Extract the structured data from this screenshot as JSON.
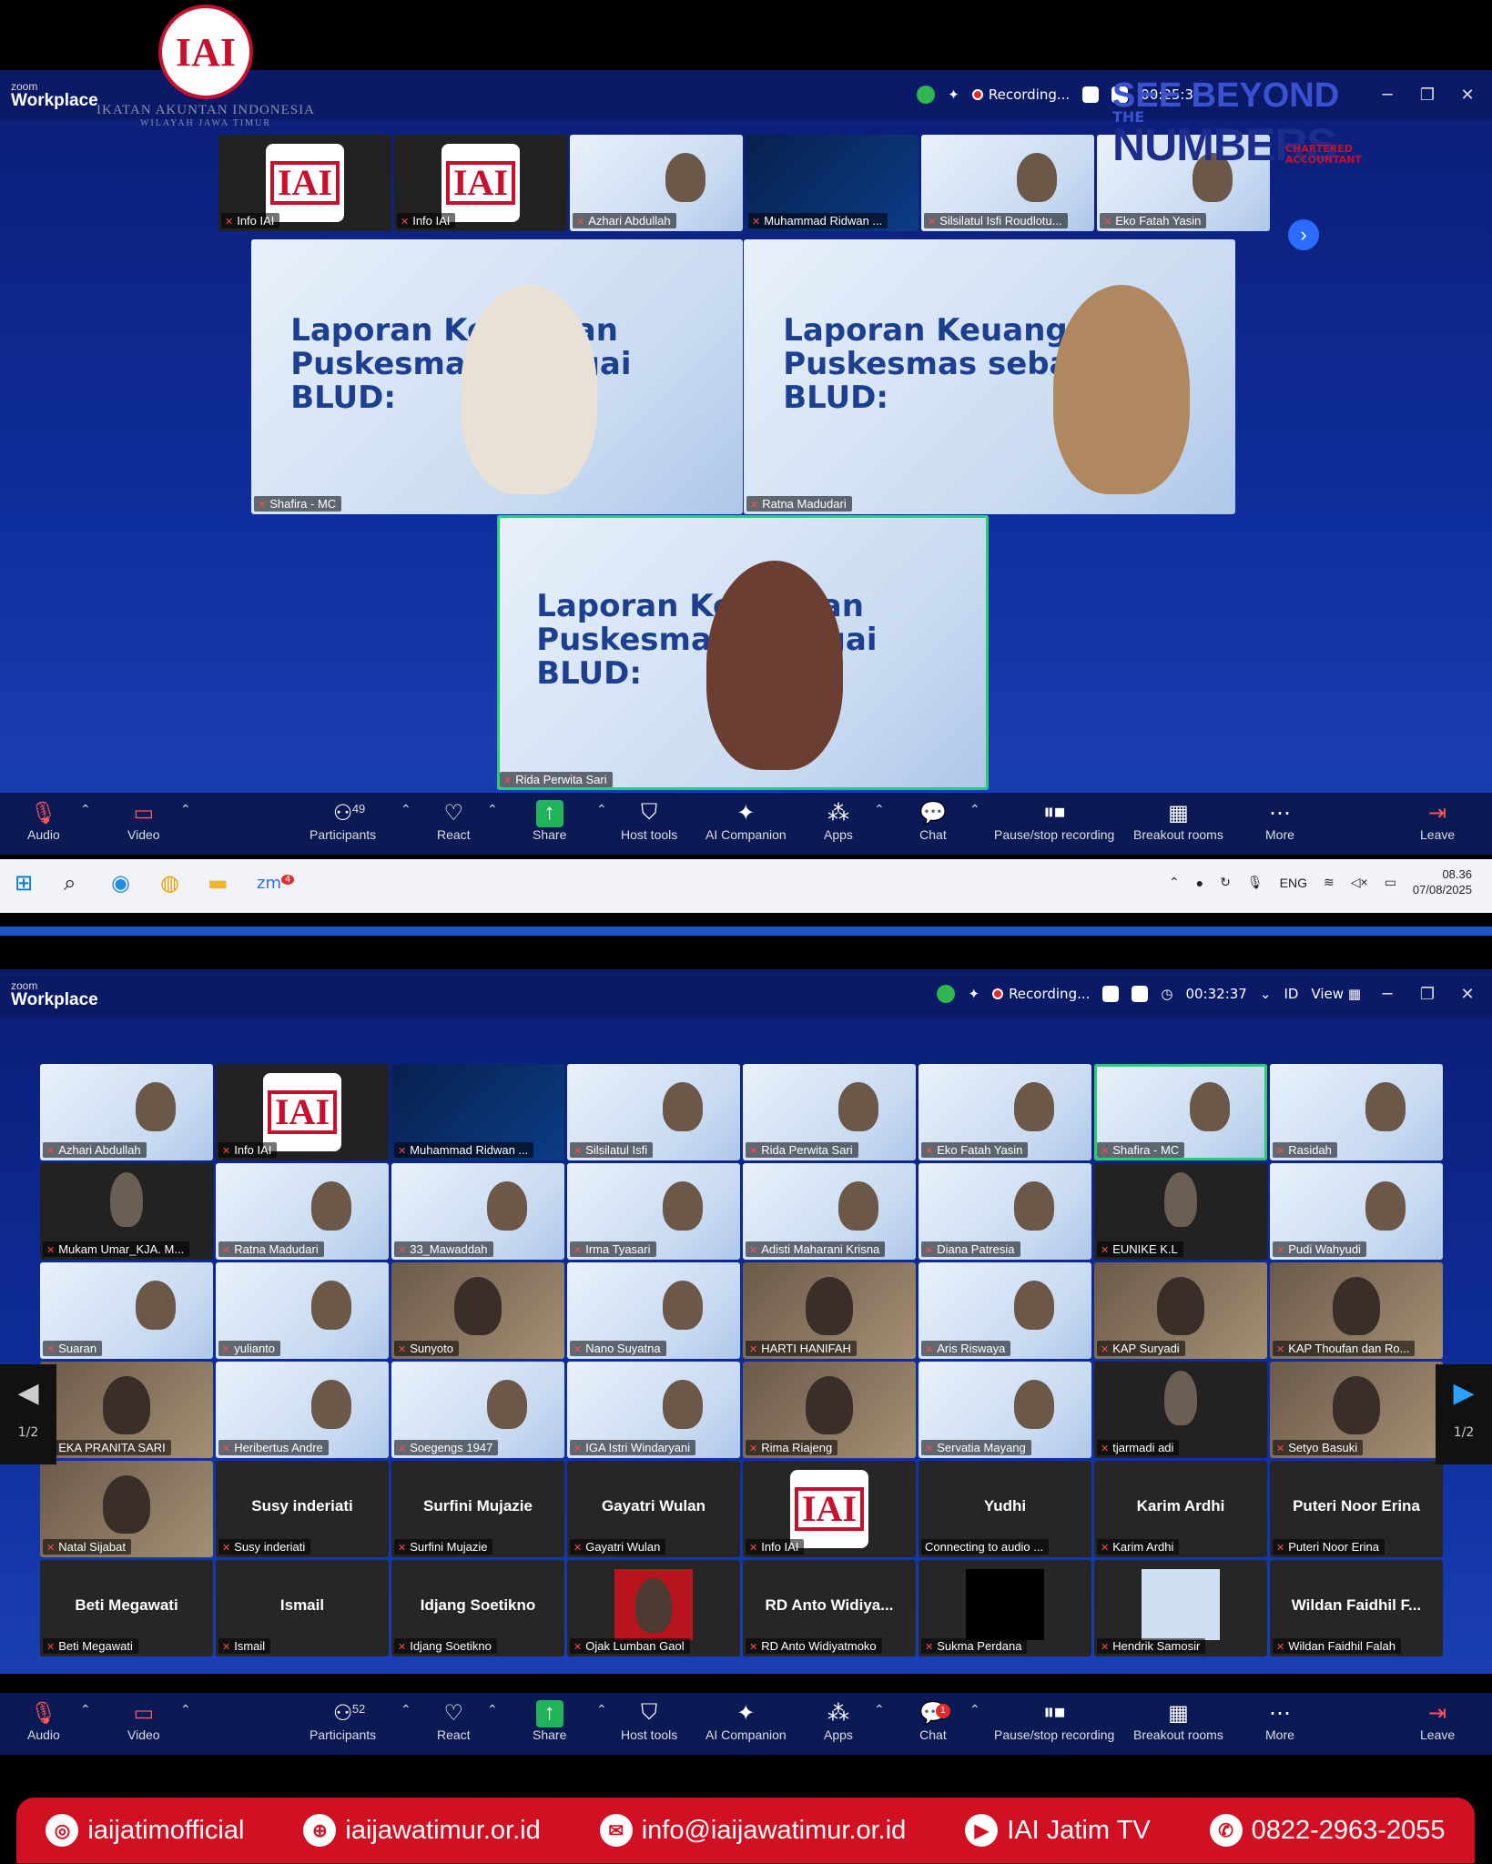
{
  "branding": {
    "org_short": "IAI",
    "org_name": "IKATAN AKUNTAN INDONESIA",
    "org_region": "WILAYAH JAWA TIMUR",
    "campaign_l1": "SEE BEYOND",
    "campaign_l2": "THE",
    "campaign_l3": "NUMBERS",
    "ca_l1": "CHARTERED",
    "ca_l2": "ACCOUNTANT"
  },
  "window1": {
    "app_small": "zoom",
    "app_name": "Workplace",
    "recording": "Recording...",
    "timer": "00:25:3",
    "strip": [
      {
        "name": "Info IAI",
        "kind": "logo"
      },
      {
        "name": "Info IAI",
        "kind": "logo"
      },
      {
        "name": "Azhari Abdullah",
        "kind": "slide"
      },
      {
        "name": "Muhammad Ridwan ...",
        "kind": "navy"
      },
      {
        "name": "Silsilatul Isfi Roudlotu...",
        "kind": "slide"
      },
      {
        "name": "Eko Fatah Yasin",
        "kind": "slide"
      }
    ],
    "speakers": [
      {
        "name": "Shafira - MC"
      },
      {
        "name": "Ratna Madudari"
      },
      {
        "name": "Rida Perwita Sari"
      }
    ],
    "slide_title_l1": "Laporan Keuangan",
    "slide_title_l2": "Puskesmas sebagai BLUD:",
    "toolbar": {
      "audio": "Audio",
      "video": "Video",
      "participants": "Participants",
      "participants_count": "49",
      "react": "React",
      "share": "Share",
      "host_tools": "Host tools",
      "ai": "AI Companion",
      "apps": "Apps",
      "chat": "Chat",
      "pause": "Pause/stop recording",
      "breakout": "Breakout rooms",
      "more": "More",
      "leave": "Leave"
    },
    "taskbar": {
      "zoom_badge": "4",
      "lang": "ENG",
      "time": "08.36",
      "date": "07/08/2025"
    }
  },
  "window2": {
    "app_small": "zoom",
    "app_name": "Workplace",
    "recording": "Recording...",
    "timer": "00:32:37",
    "id_label": "ID",
    "view_label": "View",
    "page": "1/2",
    "grid": [
      {
        "name": "Azhari Abdullah",
        "kind": "slide"
      },
      {
        "name": "Info IAI",
        "kind": "logo"
      },
      {
        "name": "Muhammad Ridwan ...",
        "kind": "navy"
      },
      {
        "name": "Silsilatul Isfi",
        "kind": "slide"
      },
      {
        "name": "Rida Perwita Sari",
        "kind": "slide"
      },
      {
        "name": "Eko Fatah Yasin",
        "kind": "slide"
      },
      {
        "name": "Shafira - MC",
        "kind": "slide",
        "active": true
      },
      {
        "name": "Rasidah",
        "kind": "slide"
      },
      {
        "name": "Mukam Umar_KJA. M...",
        "kind": "dark"
      },
      {
        "name": "Ratna Madudari",
        "kind": "slide"
      },
      {
        "name": "33_Mawaddah",
        "kind": "slide"
      },
      {
        "name": "Irma Tyasari",
        "kind": "slide"
      },
      {
        "name": "Adisti Maharani Krisna",
        "kind": "slide"
      },
      {
        "name": "Diana Patresia",
        "kind": "slide"
      },
      {
        "name": "EUNIKE K.L",
        "kind": "dark"
      },
      {
        "name": "Pudi Wahyudi",
        "kind": "slide"
      },
      {
        "name": "Suaran",
        "kind": "slide"
      },
      {
        "name": "yulianto",
        "kind": "slide"
      },
      {
        "name": "Sunyoto",
        "kind": "room"
      },
      {
        "name": "Nano Suyatna",
        "kind": "slide"
      },
      {
        "name": "HARTI HANIFAH",
        "kind": "room"
      },
      {
        "name": "Aris Riswaya",
        "kind": "slide"
      },
      {
        "name": "KAP Suryadi",
        "kind": "room"
      },
      {
        "name": "KAP Thoufan dan Ro...",
        "kind": "room"
      },
      {
        "name": "EKA PRANITA SARI",
        "kind": "room"
      },
      {
        "name": "Heribertus Andre",
        "kind": "slide"
      },
      {
        "name": "Soegengs 1947",
        "kind": "slide"
      },
      {
        "name": "IGA Istri Windaryani",
        "kind": "slide"
      },
      {
        "name": "Rima Riajeng",
        "kind": "room"
      },
      {
        "name": "Servatia Mayang",
        "kind": "slide"
      },
      {
        "name": "tjarmadi adi",
        "kind": "dark"
      },
      {
        "name": "Setyo Basuki",
        "kind": "room"
      },
      {
        "name": "Natal Sijabat",
        "kind": "room"
      },
      {
        "name": "Susy inderiati",
        "kind": "gallery",
        "big": "Susy inderiati"
      },
      {
        "name": "Surfini Mujazie",
        "kind": "gallery",
        "big": "Surfini Mujazie"
      },
      {
        "name": "Gayatri Wulan",
        "kind": "gallery",
        "big": "Gayatri Wulan"
      },
      {
        "name": "Info IAI",
        "kind": "gallery-logo"
      },
      {
        "name": "Connecting to audio ...",
        "kind": "gallery",
        "big": "Yudhi",
        "nomic": true
      },
      {
        "name": "Karim Ardhi",
        "kind": "gallery",
        "big": "Karim Ardhi"
      },
      {
        "name": "Puteri Noor Erina",
        "kind": "gallery",
        "big": "Puteri Noor Erina"
      },
      {
        "name": "Beti Megawati",
        "kind": "gallery",
        "big": "Beti Megawati"
      },
      {
        "name": "Ismail",
        "kind": "gallery",
        "big": "Ismail"
      },
      {
        "name": "Idjang Soetikno",
        "kind": "gallery",
        "big": "Idjang Soetikno"
      },
      {
        "name": "Ojak Lumban Gaol",
        "kind": "gallery-photo"
      },
      {
        "name": "RD Anto Widiyatmoko",
        "kind": "gallery",
        "big": "RD Anto Widiya..."
      },
      {
        "name": "Sukma Perdana",
        "kind": "gallery-black"
      },
      {
        "name": "Hendrik Samosir",
        "kind": "gallery-slide"
      },
      {
        "name": "Wildan Faidhil Falah",
        "kind": "gallery",
        "big": "Wildan Faidhil F..."
      }
    ],
    "toolbar": {
      "audio": "Audio",
      "video": "Video",
      "participants": "Participants",
      "participants_count": "52",
      "react": "React",
      "share": "Share",
      "host_tools": "Host tools",
      "ai": "AI Companion",
      "apps": "Apps",
      "chat": "Chat",
      "chat_badge": "1",
      "pause": "Pause/stop recording",
      "breakout": "Breakout rooms",
      "more": "More",
      "leave": "Leave"
    }
  },
  "footer": {
    "instagram": "iaijatimofficial",
    "website": "iaijawatimur.or.id",
    "email": "info@iaijawatimur.or.id",
    "youtube": "IAI Jatim TV",
    "whatsapp": "0822-2963-2055"
  },
  "colors": {
    "zoom_bg": "#0c1f7a",
    "toolbar_bg": "#0b1a55",
    "iai_red": "#c8102e",
    "active_green": "#2ecc71",
    "footer_red": "#d21023"
  }
}
